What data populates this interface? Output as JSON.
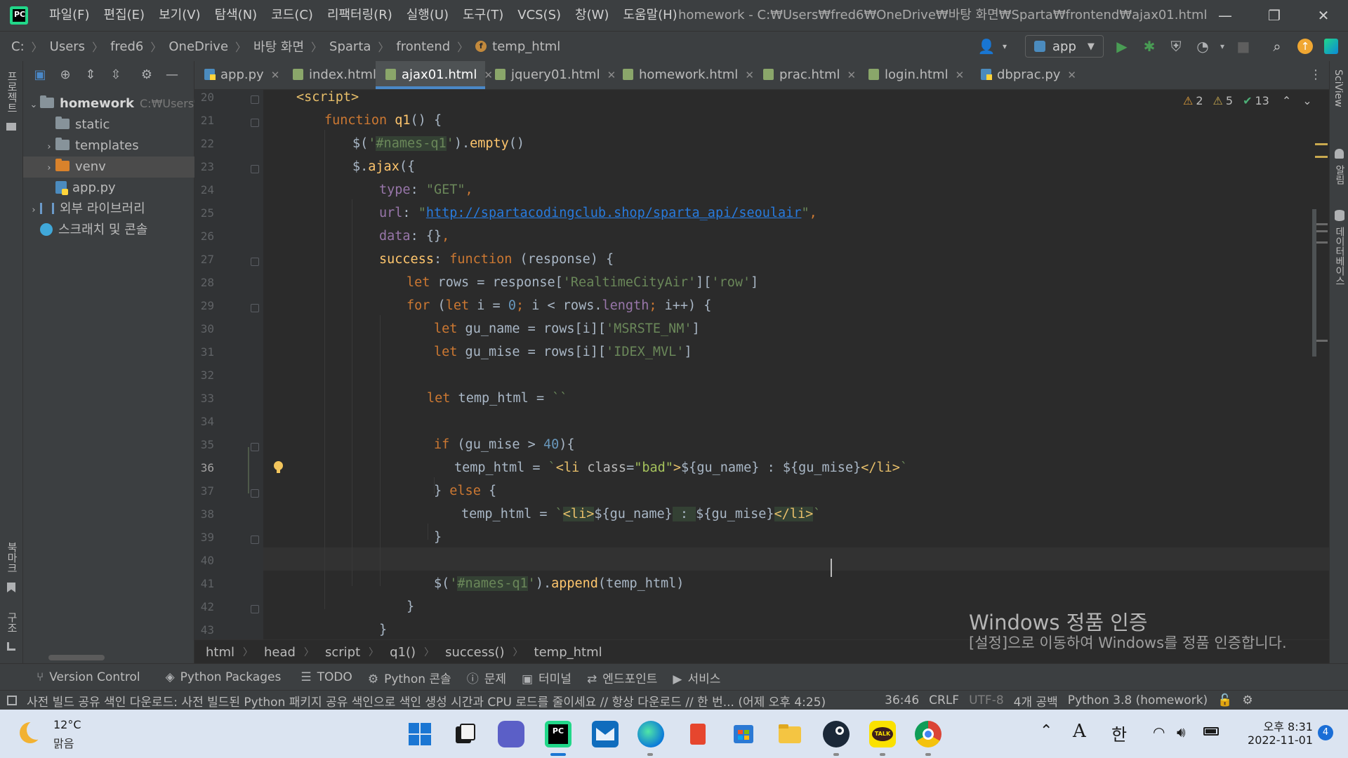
{
  "titlebar": {
    "logo_text": "PC",
    "menus": [
      "파일(F)",
      "편집(E)",
      "보기(V)",
      "탐색(N)",
      "코드(C)",
      "리팩터링(R)",
      "실행(U)",
      "도구(T)",
      "VCS(S)",
      "창(W)",
      "도움말(H)"
    ],
    "window_title": "homework - C:₩Users₩fred6₩OneDrive₩바탕 화면₩Sparta₩frontend₩ajax01.html",
    "minimize": "—",
    "restore": "❐",
    "close": "✕"
  },
  "navbar": {
    "breadcrumb": [
      "C:",
      "Users",
      "fred6",
      "OneDrive",
      "바탕 화면",
      "Sparta",
      "frontend",
      "temp_html"
    ],
    "run_config": "app"
  },
  "left_strip": {
    "project_label": "프로젝트",
    "bookmarks_label": "북마크",
    "structure_label": "구조"
  },
  "right_strip": {
    "sciview_label": "SciView",
    "notifications_label": "알림",
    "database_label": "데이터베이스"
  },
  "project_tree": [
    {
      "label": "homework",
      "hint": "C:₩Users₩",
      "type": "folder",
      "depth": 0,
      "expanded": true,
      "bold": true
    },
    {
      "label": "static",
      "type": "folder",
      "depth": 1
    },
    {
      "label": "templates",
      "type": "folder",
      "depth": 1,
      "collapsed": true
    },
    {
      "label": "venv",
      "type": "folder-orange",
      "depth": 1,
      "collapsed": true,
      "selected": true
    },
    {
      "label": "app.py",
      "type": "python",
      "depth": 1
    },
    {
      "label": "외부 라이브러리",
      "type": "library",
      "depth": 0,
      "collapsed": true
    },
    {
      "label": "스크래치 및 콘솔",
      "type": "scratch",
      "depth": 0
    }
  ],
  "tabs": [
    {
      "label": "app.py",
      "icon": "python"
    },
    {
      "label": "index.html",
      "icon": "html"
    },
    {
      "label": "ajax01.html",
      "icon": "html",
      "active": true
    },
    {
      "label": "jquery01.html",
      "icon": "html"
    },
    {
      "label": "homework.html",
      "icon": "html"
    },
    {
      "label": "prac.html",
      "icon": "html"
    },
    {
      "label": "login.html",
      "icon": "html"
    },
    {
      "label": "dbprac.py",
      "icon": "python"
    }
  ],
  "inspections": {
    "warnings": "2",
    "weak_warnings": "5",
    "ok": "13"
  },
  "line_numbers": [
    "20",
    "21",
    "22",
    "23",
    "24",
    "25",
    "26",
    "27",
    "28",
    "29",
    "30",
    "31",
    "32",
    "33",
    "34",
    "35",
    "36",
    "37",
    "38",
    "39",
    "40",
    "41",
    "42",
    "43"
  ],
  "code_lines": [
    "<script>",
    "function q1() {",
    "$('#names-q1').empty()",
    "$.ajax({",
    "type: \"GET\",",
    "url: \"http://spartacodingclub.shop/sparta_api/seoulair\",",
    "data: {},",
    "success: function (response) {",
    "let rows = response['RealtimeCityAir']['row']",
    "for (let i = 0; i < rows.length; i++) {",
    "let gu_name = rows[i]['MSRSTE_NM']",
    "let gu_mise = rows[i]['IDEX_MVL']",
    "",
    "let temp_html = ``",
    "",
    "if (gu_mise > 40){",
    "temp_html = `<li class=\"bad\">${gu_name} : ${gu_mise}</li>`",
    "} else {",
    "temp_html = `<li>${gu_name} : ${gu_mise}</li>`",
    "}",
    "",
    "$('#names-q1').append(temp_html)",
    "}",
    "}"
  ],
  "code_breadcrumb": [
    "html",
    "head",
    "script",
    "q1()",
    "success()",
    "temp_html"
  ],
  "watermark": {
    "title": "Windows 정품 인증",
    "text": "[설정]으로 이동하여 Windows를 정품 인증합니다."
  },
  "tool_windows": [
    {
      "label": "Version Control",
      "icon": "branch-icon"
    },
    {
      "label": "Python Packages",
      "icon": "packages-icon"
    },
    {
      "label": "TODO",
      "icon": "todo-icon"
    },
    {
      "label": "Python 콘솔",
      "icon": "python-console-icon"
    },
    {
      "label": "문제",
      "icon": "problems-icon"
    },
    {
      "label": "터미널",
      "icon": "terminal-icon"
    },
    {
      "label": "엔드포인트",
      "icon": "endpoints-icon"
    },
    {
      "label": "서비스",
      "icon": "services-icon"
    }
  ],
  "statusbar": {
    "message": "사전 빌드 공유 색인 다운로드: 사전 빌드된 Python 패키지 공유 색인으로 색인 생성 시간과 CPU 로드를 줄이세요 // 항상 다운로드 // 한 번... (어제 오후 4:25)",
    "position": "36:46",
    "line_sep": "CRLF",
    "encoding": "UTF-8",
    "indent": "4개 공백",
    "interpreter": "Python 3.8 (homework)"
  },
  "taskbar": {
    "weather_temp": "12°C",
    "weather_desc": "맑음",
    "ime_a": "A",
    "ime_lang": "한",
    "time": "오후 8:31",
    "date": "2022-11-01",
    "notification_count": "4",
    "apps": [
      "windows-start",
      "task-view",
      "teams-chat",
      "pycharm",
      "mail",
      "edge",
      "office",
      "microsoft-store",
      "file-explorer",
      "steam",
      "kakaotalk",
      "chrome"
    ],
    "kakaotalk_label": "TALK"
  },
  "colors": {
    "editor_bg": "#2b2b2b",
    "panel_bg": "#3c3f41",
    "accent": "#4a88c7",
    "keyword": "#cc7832",
    "string": "#6a8759",
    "function": "#ffc66d",
    "number": "#6897bb"
  }
}
